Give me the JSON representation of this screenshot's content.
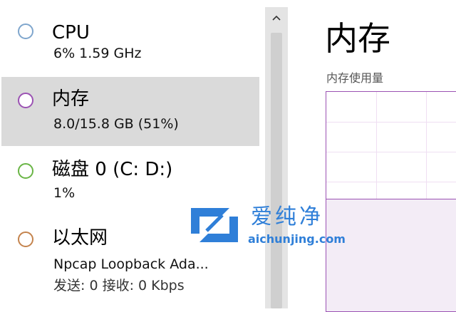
{
  "sidebar": {
    "items": [
      {
        "title": "CPU",
        "sub": "6%  1.59 GHz",
        "ring_color": "#7fa6cd"
      },
      {
        "title": "内存",
        "sub": "8.0/15.8 GB (51%)",
        "ring_color": "#9b52b3"
      },
      {
        "title": "磁盘 0 (C: D:)",
        "sub": "1%",
        "ring_color": "#69b545"
      },
      {
        "title": "以太网",
        "sub": "Npcap Loopback Ada...",
        "sub2": "发送: 0  接收: 0 Kbps",
        "ring_color": "#c4834d"
      }
    ]
  },
  "scrollbar": {
    "up_glyph": "^"
  },
  "main": {
    "title": "内存",
    "graph_label": "内存使用量",
    "usage_fraction": 0.51,
    "accent": "#9b52b3"
  },
  "watermark": {
    "name": "爱纯净",
    "url": "aichunjing.com"
  }
}
